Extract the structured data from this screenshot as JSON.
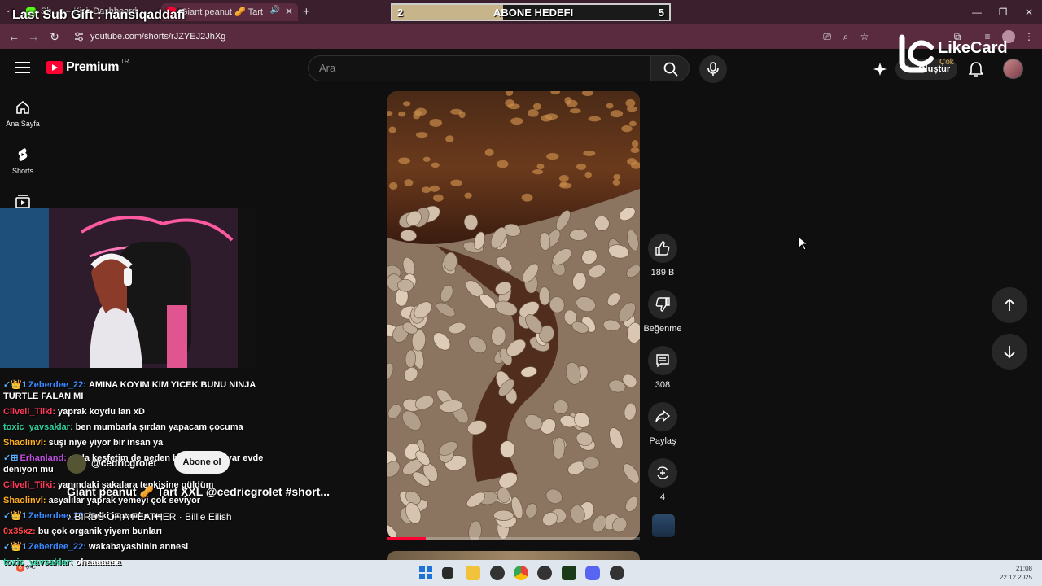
{
  "browser": {
    "tabs": [
      {
        "label": "Sh...s – Kick Dashboard"
      },
      {
        "label": "Giant peanut 🥜 Tart XXL @c..."
      }
    ],
    "url": "youtube.com/shorts/rJZYEJ2JhXg"
  },
  "overlay": {
    "sub_gift": "Last Sub Gift : hansiqaddafi",
    "goal": {
      "current": "2",
      "label": "ABONE HEDEFI",
      "target": "5",
      "progress": 0.4
    },
    "sponsor": {
      "name": "LikeCard",
      "sub": "Çok"
    }
  },
  "youtube": {
    "logo_text": "Premium",
    "country": "TR",
    "search_placeholder": "Ara",
    "create_label": "Oluştur",
    "sidebar": [
      {
        "label": "Ana Sayfa",
        "icon": "home-icon"
      },
      {
        "label": "Shorts",
        "icon": "shorts-icon"
      },
      {
        "label": "",
        "icon": "subscriptions-icon"
      }
    ],
    "short": {
      "channel": "@cedricgrolet",
      "subscribe_label": "Abone ol",
      "title": "Giant peanut 🥜 Tart XXL @cedricgrolet #short...",
      "music": "BIRDS OF A FEATHER · Billie Eilish",
      "progress": 0.15
    },
    "actions": {
      "like_count": "189 B",
      "dislike_label": "Beğenme",
      "comment_count": "308",
      "share_label": "Paylaş",
      "remix_count": "4"
    }
  },
  "chat": [
    {
      "user": "Zeberdee_22:",
      "color": "#3a8bff",
      "badges": "✓👑1",
      "text": "AMINA KOYIM KIM YICEK BUNU NINJA TURTLE FALAN MI"
    },
    {
      "user": "Cilveli_Tilki:",
      "color": "#ff3b5c",
      "badges": "",
      "text": "yaprak koydu lan xD"
    },
    {
      "user": "toxic_yavsaklar:",
      "color": "#2fd3a0",
      "badges": "",
      "text": "ben mumbarla şırdan yapacam çocuma"
    },
    {
      "user": "Shaolinvl:",
      "color": "#ffb020",
      "badges": "",
      "text": "suşi niye yiyor bir insan ya"
    },
    {
      "user": "Erhanland:",
      "color": "#c04be0",
      "badges": "✓⊞",
      "text": "ayda keşfetim de neden böyle şeyler var evde deniyon mu"
    },
    {
      "user": "Cilveli_Tilki:",
      "color": "#ff3b5c",
      "badges": "",
      "text": "yanındaki şakalara tepkisine güldüm"
    },
    {
      "user": "Shaolinvl:",
      "color": "#ffb020",
      "badges": "",
      "text": "asyalılar yaprak yemeyi çok seviyor"
    },
    {
      "user": "Zeberdee_22:",
      "color": "#3a8bff",
      "badges": "✓👑1",
      "text": "belki japondur aq"
    },
    {
      "user": "0x35xz:",
      "color": "#ff4444",
      "badges": "",
      "text": "bu çok organik yiyem bunları"
    },
    {
      "user": "Zeberdee_22:",
      "color": "#3a8bff",
      "badges": "✓👑1",
      "text": "wakabayashinin annesi"
    },
    {
      "user": "toxic_yavsaklar:",
      "color": "#2fd3a0",
      "badges": "",
      "text": "ohaaaaaaa"
    }
  ],
  "taskbar": {
    "weather": "6°C",
    "weather_badge": "8",
    "time": "21:08",
    "date": "22.12.2025"
  },
  "colors": {
    "accent": "#ff0033",
    "chrome": "#5a2a3e",
    "bg": "#0f0f0f"
  }
}
